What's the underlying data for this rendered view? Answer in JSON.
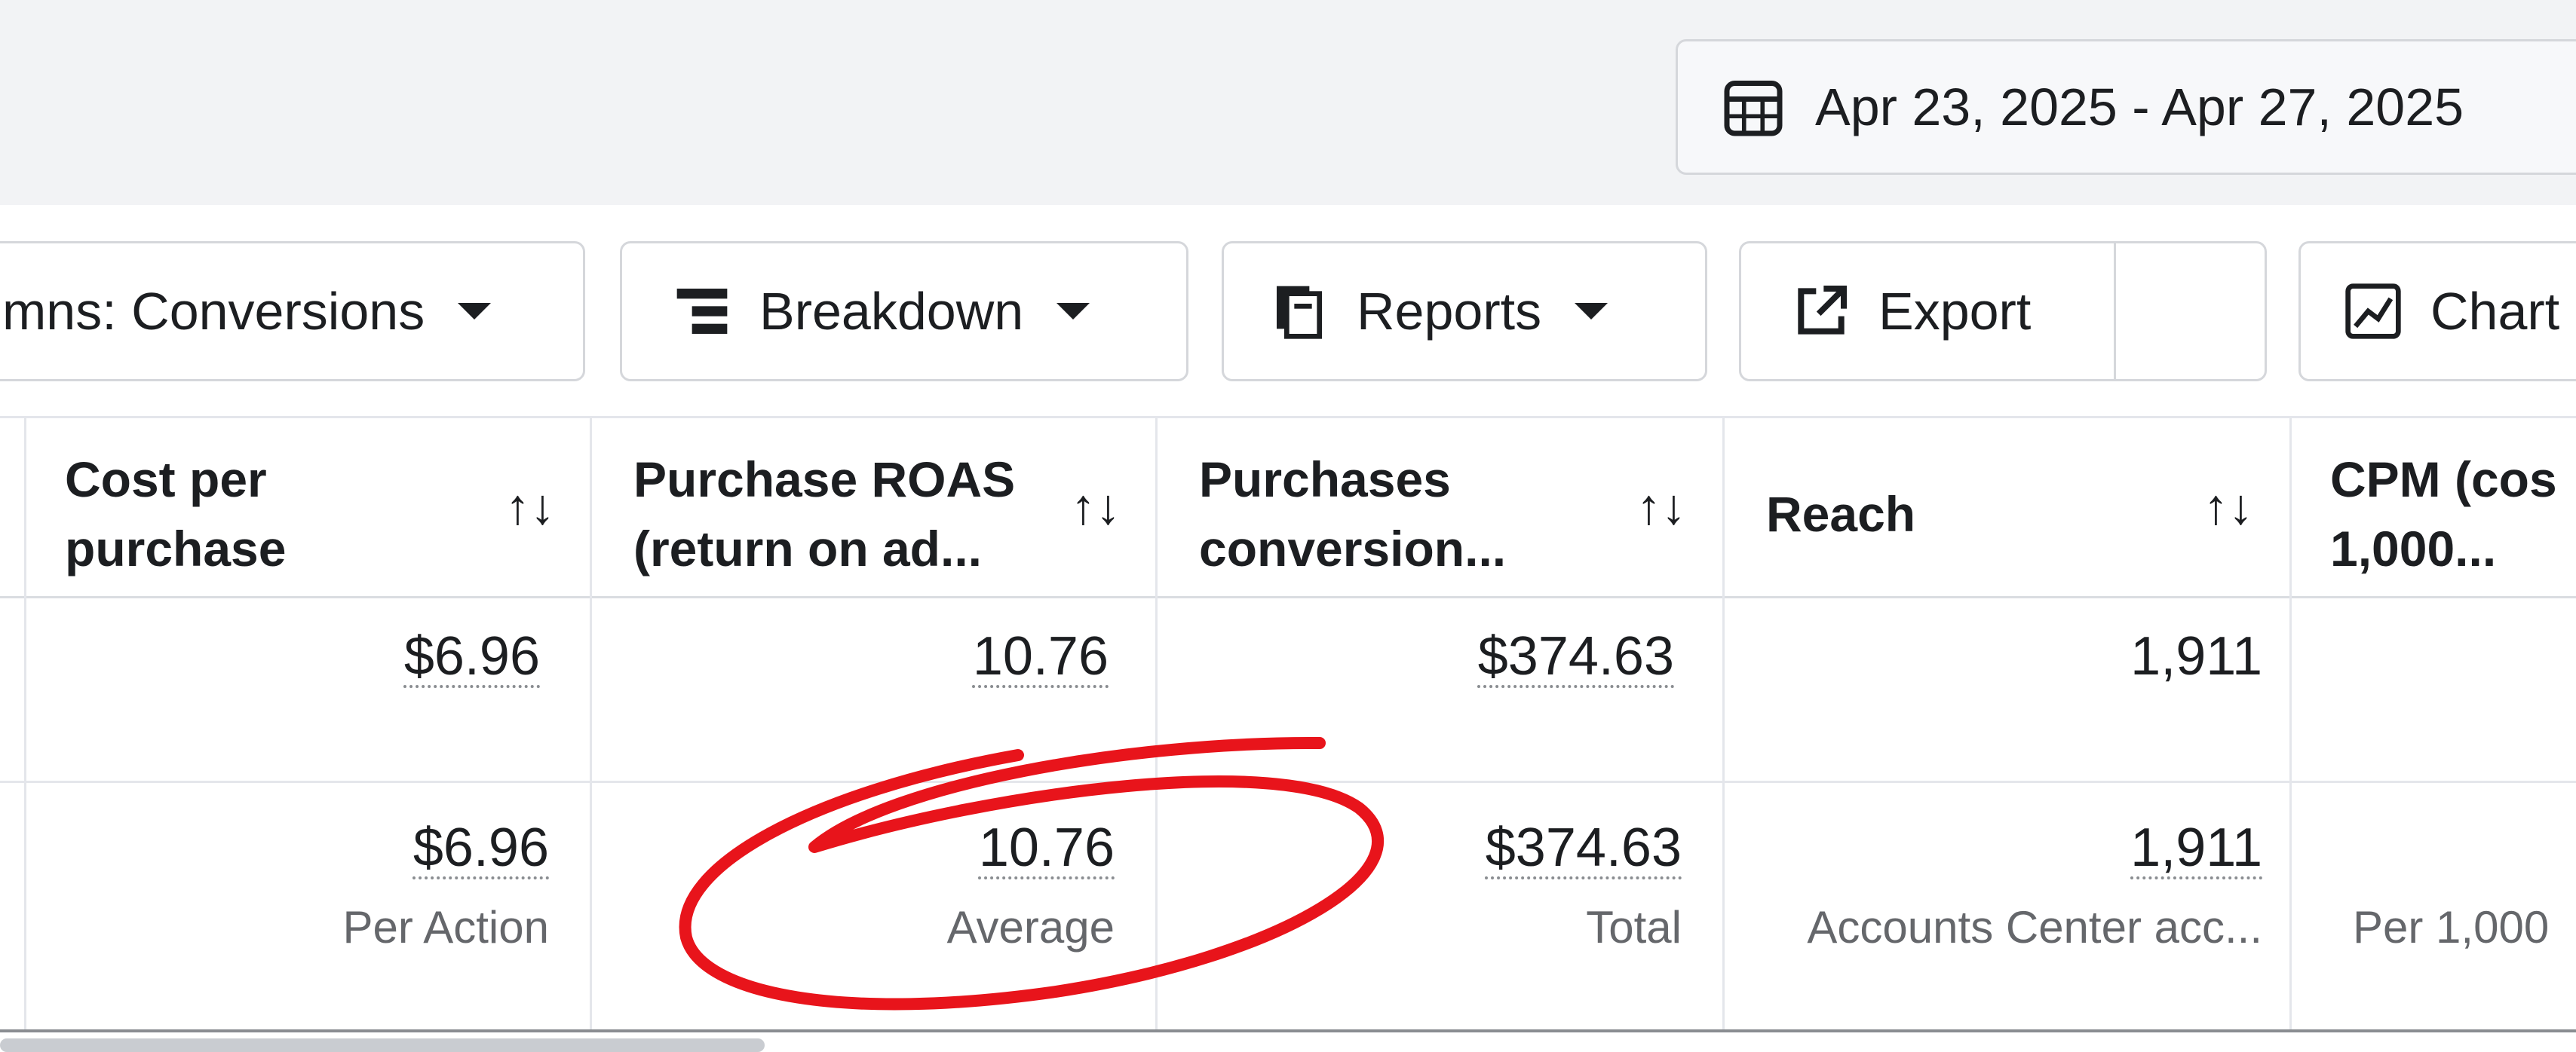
{
  "date_range": {
    "label": "Apr 23, 2025 - Apr 27, 2025"
  },
  "toolbar": {
    "columns_label": "mns: Conversions",
    "breakdown_label": "Breakdown",
    "reports_label": "Reports",
    "export_label": "Export",
    "charts_label": "Chart"
  },
  "table": {
    "headers": [
      {
        "line1": "Cost per",
        "line2": "purchase"
      },
      {
        "line1": "Purchase ROAS",
        "line2": "(return on ad..."
      },
      {
        "line1": "Purchases",
        "line2": "conversion..."
      },
      {
        "line1": "Reach",
        "line2": ""
      },
      {
        "line1": "CPM (cos",
        "line2": "1,000..."
      }
    ],
    "sort_glyph": "↑↓",
    "rows": [
      {
        "cells": [
          "$6.96",
          "10.76",
          "$374.63",
          "1,911"
        ]
      }
    ],
    "summary": {
      "values": [
        "$6.96",
        "10.76",
        "$374.63",
        "1,911"
      ],
      "labels": [
        "Per Action",
        "Average",
        "Total",
        "Accounts Center acc...",
        "Per 1,000"
      ]
    }
  },
  "colors": {
    "annotation": "#e8141b",
    "border": "#d5d7db",
    "muted_text": "#65676b"
  }
}
